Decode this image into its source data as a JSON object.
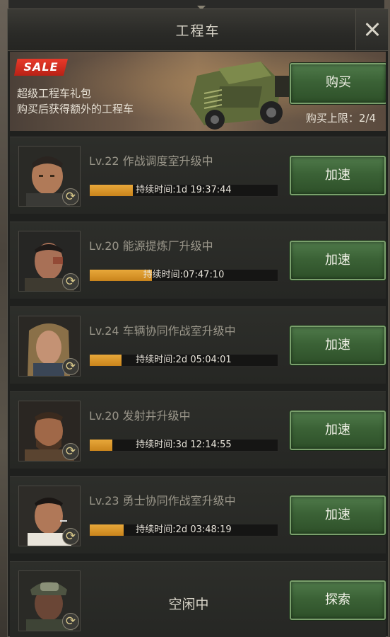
{
  "header": {
    "title": "工程车"
  },
  "banner": {
    "sale_label": "SALE",
    "line1": "超级工程车礼包",
    "line2": "购买后获得额外的工程车",
    "buy_label": "购买",
    "limit_text": "购买上限：2/4"
  },
  "rows": [
    {
      "task": "Lv.22 作战调度室升级中",
      "timer": "持续时间:1d 19:37:44",
      "progress": 0.23,
      "button": "加速"
    },
    {
      "task": "Lv.20 能源提炼厂升级中",
      "timer": "持续时间:07:47:10",
      "progress": 0.33,
      "button": "加速"
    },
    {
      "task": "Lv.24 车辆协同作战室升级中",
      "timer": "持续时间:2d 05:04:01",
      "progress": 0.17,
      "button": "加速"
    },
    {
      "task": "Lv.20 发射井升级中",
      "timer": "持续时间:3d 12:14:55",
      "progress": 0.12,
      "button": "加速"
    },
    {
      "task": "Lv.23 勇士协同作战室升级中",
      "timer": "持续时间:2d 03:48:19",
      "progress": 0.18,
      "button": "加速"
    }
  ],
  "idle_row": {
    "status": "空闲中",
    "button": "探索"
  },
  "colors": {
    "accent_green": "#3b6236",
    "progress_orange": "#d8941e",
    "sale_red": "#d82c1e"
  }
}
